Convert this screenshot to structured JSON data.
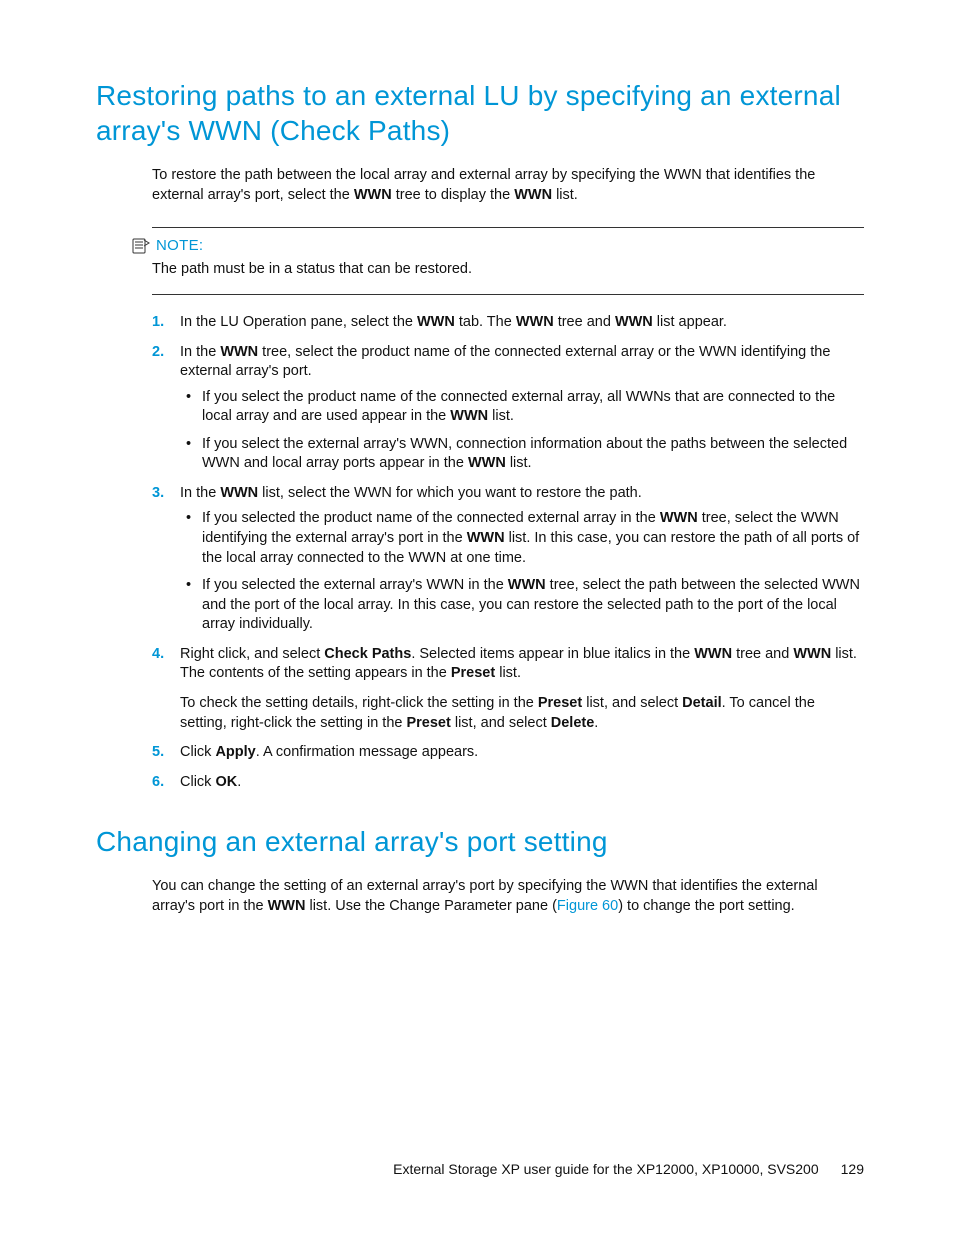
{
  "section1": {
    "heading": "Restoring paths to an external LU by specifying an external array's WWN (Check Paths)",
    "intro_a": "To restore the path between the local array and external array by specifying the WWN that identifies the external array's port, select the ",
    "intro_b": " tree to display the ",
    "intro_c": " list.",
    "wwn": "WWN",
    "note_label": "NOTE:",
    "note_body": "The path must be in a status that can be restored.",
    "step1_a": "In the LU Operation pane, select the ",
    "step1_b": " tab. The ",
    "step1_c": " tree and ",
    "step1_d": " list appear.",
    "step2_a": "In the ",
    "step2_b": " tree, select the product name of the connected external array or the WWN identifying the external array's port.",
    "step2_bullet1_a": "If you select the product name of the connected external array, all WWNs that are connected to the local array and are used appear in the ",
    "step2_bullet1_b": " list.",
    "step2_bullet2_a": "If you select the external array's WWN, connection information about the paths between the selected WWN and local array ports appear in the ",
    "step2_bullet2_b": " list.",
    "step3_a": "In the ",
    "step3_b": " list, select the WWN for which you want to restore the path.",
    "step3_bullet1_a": "If you selected the product name of the connected external array in the ",
    "step3_bullet1_b": " tree, select the WWN identifying the external array's port in the ",
    "step3_bullet1_c": " list. In this case, you can restore the path of all ports of the local array connected to the WWN at one time.",
    "step3_bullet2_a": "If you selected the external array's WWN in the ",
    "step3_bullet2_b": " tree, select the path between the selected WWN and the port of the local array. In this case, you can restore the selected path to the port of the local array individually.",
    "step4_a": "Right click, and select ",
    "step4_check_paths": "Check Paths",
    "step4_b": ". Selected items appear in blue italics in the ",
    "step4_c": " tree and ",
    "step4_d": " list. The contents of the setting appears in the ",
    "step4_preset": "Preset",
    "step4_e": " list.",
    "step4_para2_a": "To check the setting details, right-click the setting in the ",
    "step4_para2_b": " list, and select ",
    "step4_detail": "Detail",
    "step4_para2_c": ". To cancel the setting, right-click the setting in the ",
    "step4_para2_d": " list, and select ",
    "step4_delete": "Delete",
    "step4_para2_e": ".",
    "step5_a": "Click ",
    "step5_apply": "Apply",
    "step5_b": ". A confirmation message appears.",
    "step6_a": "Click ",
    "step6_ok": "OK",
    "step6_b": "."
  },
  "section2": {
    "heading": "Changing an external array's port setting",
    "body_a": "You can change the setting of an external array's port by specifying the WWN that identifies the external array's port in the ",
    "wwn": "WWN",
    "body_b": " list. Use the Change Parameter pane (",
    "fig_link": "Figure 60",
    "body_c": ") to change the port setting."
  },
  "footer": {
    "title": "External Storage XP user guide for the XP12000, XP10000, SVS200",
    "page": "129"
  }
}
